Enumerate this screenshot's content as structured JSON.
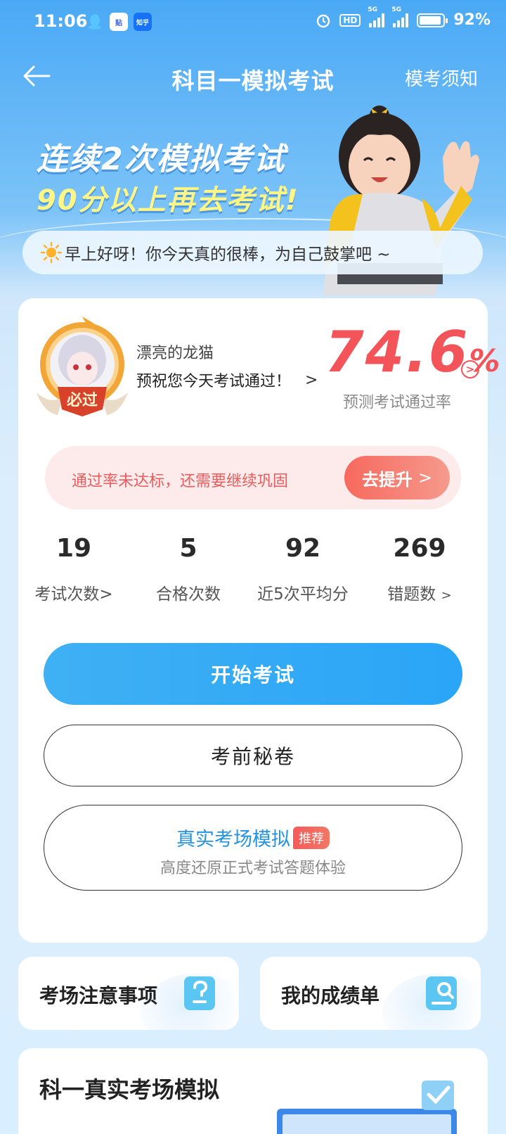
{
  "status_bar": {
    "time": "11:06",
    "apps": [
      "qq-icon",
      "tieba-icon",
      "zhihu-icon"
    ],
    "zhihu_label": "知乎",
    "tieba_label": "贴",
    "battery_percent": "92%",
    "battery_level": 0.92,
    "network_labels": [
      "5G",
      "5G"
    ],
    "hd_label": "HD"
  },
  "nav": {
    "title": "科目一模拟考试",
    "notice": "模考须知"
  },
  "banner": {
    "line1": "连续2次模拟考试",
    "line2": "90分以上再去考试!",
    "greeting": "早上好呀！你今天真的很棒，为自己鼓掌吧 ~"
  },
  "profile": {
    "badge_text": "必过",
    "user_name": "漂亮的龙猫",
    "wish": "预祝您今天考试通过！"
  },
  "pass_rate": {
    "value": "74.6",
    "unit": "%",
    "label": "预测考试通过率"
  },
  "warning": {
    "text": "通过率未达标，还需要继续巩固",
    "button": "去提升"
  },
  "stats": [
    {
      "value": "19",
      "label": "考试次数>"
    },
    {
      "value": "5",
      "label": "合格次数"
    },
    {
      "value": "92",
      "label": "近5次平均分"
    },
    {
      "value": "269",
      "label": "错题数"
    }
  ],
  "actions": {
    "start": "开始考试",
    "secret": "考前秘卷",
    "real_title": "真实考场模拟",
    "real_badge": "推荐",
    "real_sub": "高度还原正式考试答题体验"
  },
  "tiles": {
    "notice": "考场注意事项",
    "report": "我的成绩单"
  },
  "section": {
    "title": "科一真实考场模拟"
  },
  "colors": {
    "primary": "#2aa5f7",
    "rate_red": "#f25459",
    "warn_bg": "#fdeaea",
    "banner_yellow": "#fdf585"
  }
}
